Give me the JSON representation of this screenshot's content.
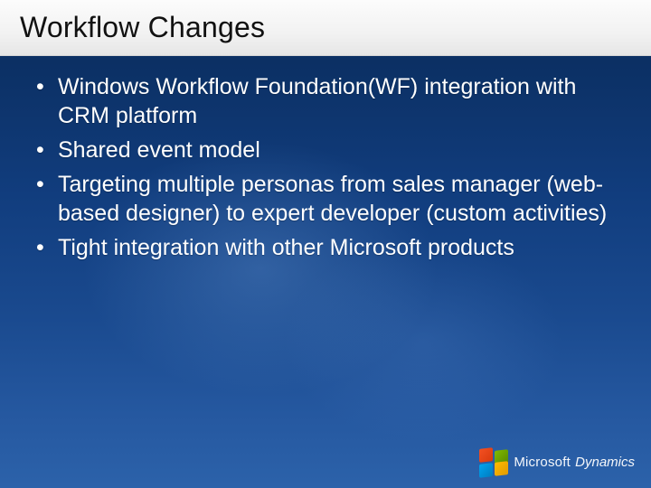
{
  "title": "Workflow Changes",
  "bullets": [
    "Windows Workflow Foundation(WF) integration with CRM platform",
    "Shared event model",
    "Targeting multiple personas from sales manager (web-based designer) to expert developer (custom activities)",
    "Tight integration with other Microsoft products"
  ],
  "footer": {
    "brand1": "Microsoft",
    "brand2": "Dynamics"
  }
}
